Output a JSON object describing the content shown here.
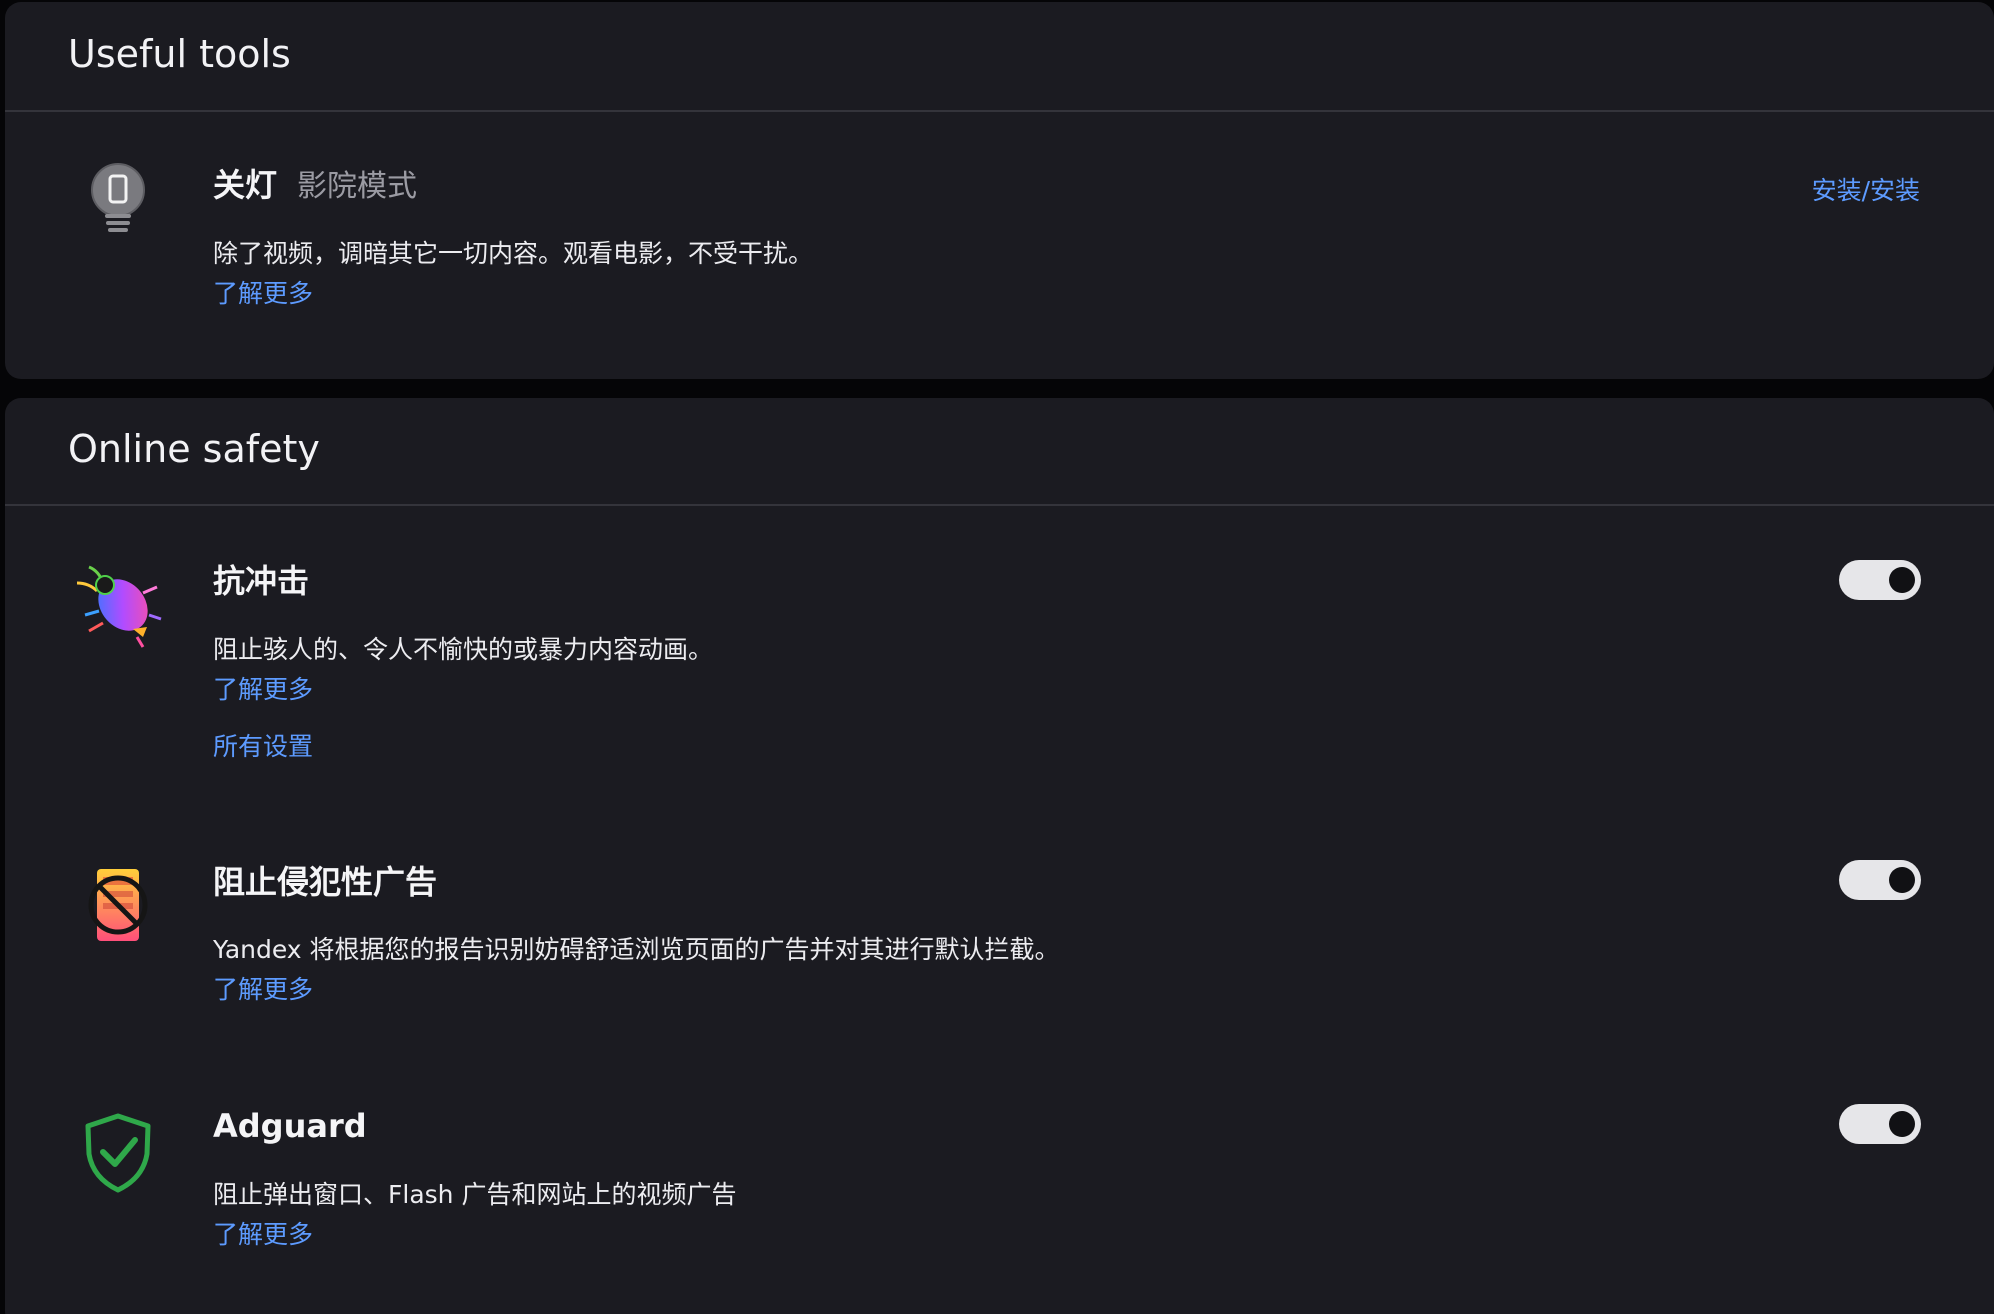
{
  "useful_tools": {
    "title": "Useful tools",
    "lights_off": {
      "title": "关灯",
      "subtitle": "影院模式",
      "description": "除了视频，调暗其它一切内容。观看电影，不受干扰。",
      "learn_more": "了解更多",
      "install_label": "安装/安装",
      "icon": "lightbulb-icon"
    }
  },
  "online_safety": {
    "title": "Online safety",
    "items": [
      {
        "title": "抗冲击",
        "description": "阻止骇人的、令人不愉快的或暴力内容动画。",
        "learn_more": "了解更多",
        "all_settings": "所有设置",
        "enabled": true,
        "icon": "shock-bug-icon"
      },
      {
        "title": "阻止侵犯性广告",
        "description": "Yandex 将根据您的报告识别妨碍舒适浏览页面的广告并对其进行默认拦截。",
        "learn_more": "了解更多",
        "enabled": true,
        "icon": "blocked-ad-icon"
      },
      {
        "title": "Adguard",
        "description": "阻止弹出窗口、Flash 广告和网站上的视频广告",
        "learn_more": "了解更多",
        "enabled": true,
        "icon": "adguard-shield-icon"
      }
    ]
  },
  "colors": {
    "background": "#050507",
    "card": "#1b1b21",
    "link": "#5d9bff",
    "toggle_on": "#e6e6e9"
  }
}
